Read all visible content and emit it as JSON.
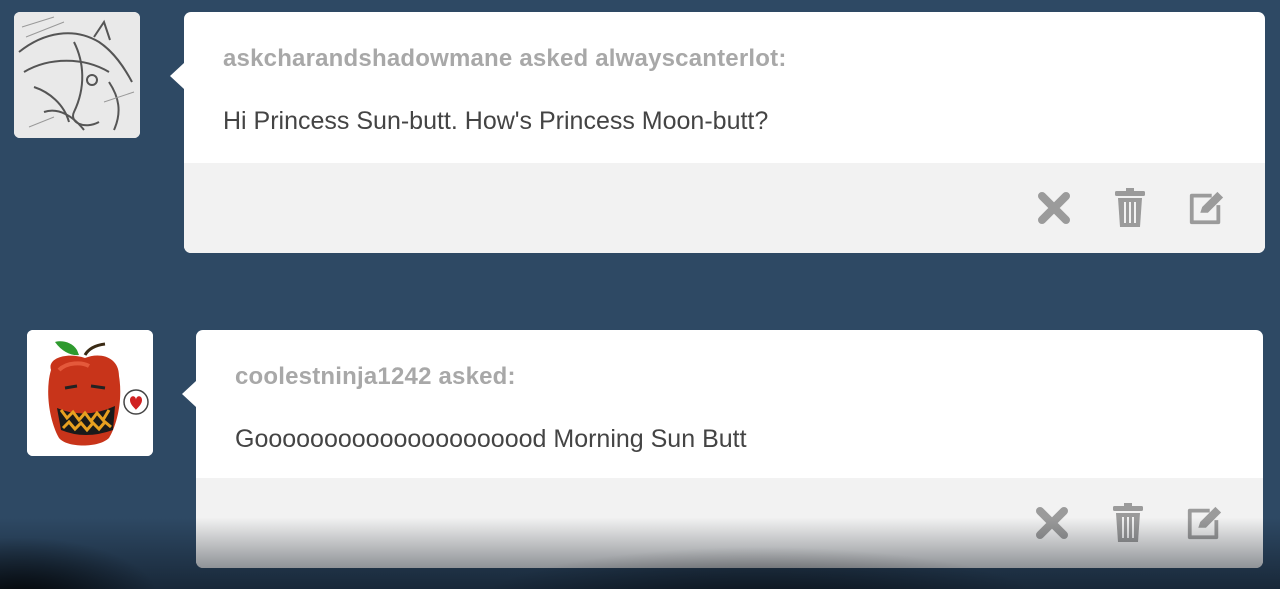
{
  "posts": [
    {
      "asker": "askcharandshadowmane asked alwayscanterlot:",
      "question": "Hi Princess Sun-butt. How's Princess Moon-butt?",
      "avatar": "sketch-pony-avatar"
    },
    {
      "asker": "coolestninja1242 asked:",
      "question": "Gooooooooooooooooooood Morning Sun Butt",
      "avatar": "apple-monster-avatar"
    }
  ],
  "actions": [
    "delete-x-icon",
    "trash-icon",
    "edit-icon"
  ],
  "colors": {
    "background": "#2e4964",
    "card": "#ffffff",
    "footer": "#f2f2f2",
    "icon": "#9b9b9b",
    "asker_text": "#a8a8a8",
    "question_text": "#444444"
  }
}
